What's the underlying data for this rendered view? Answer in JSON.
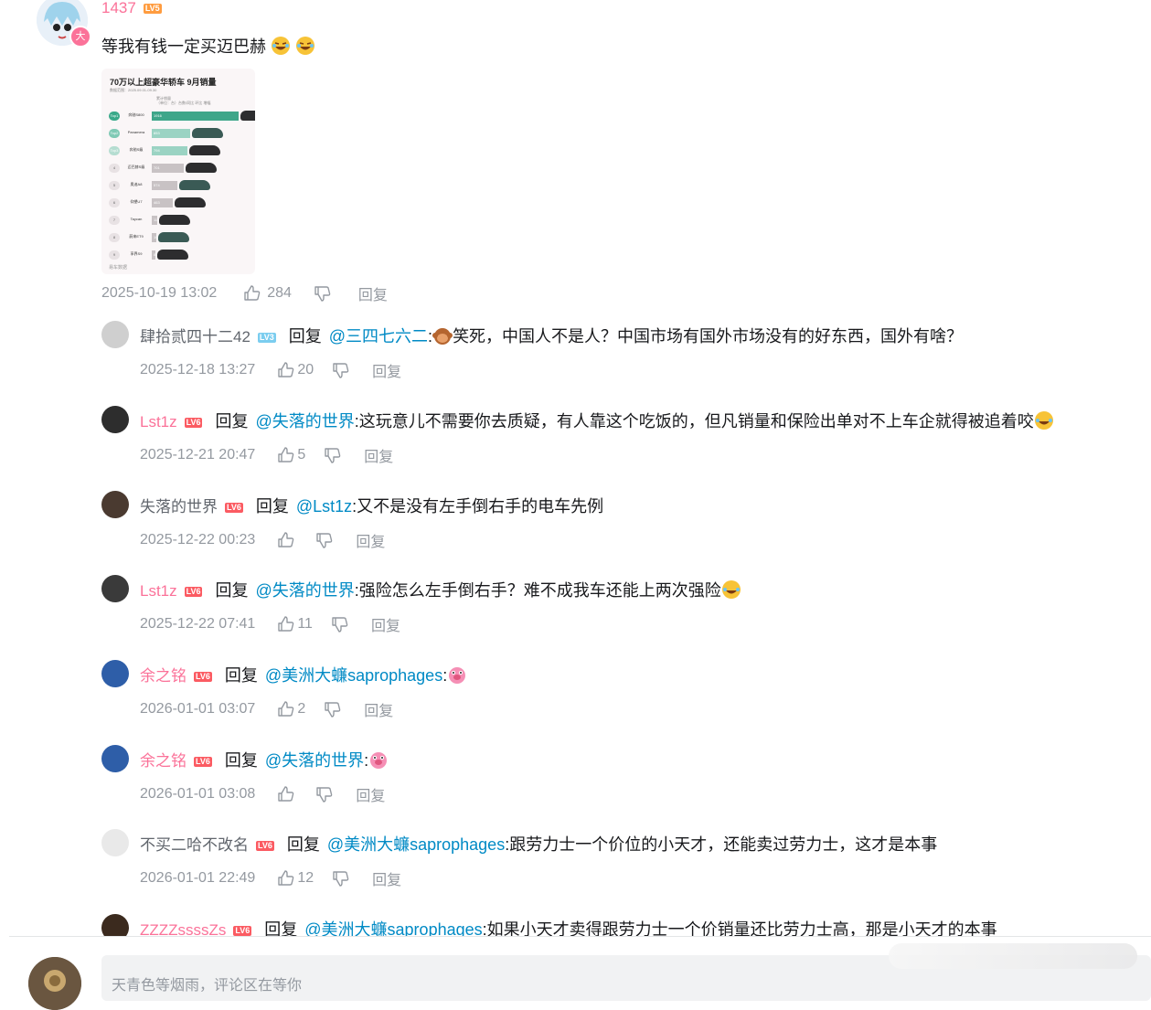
{
  "main_comment": {
    "username": "1437",
    "level": "LV5",
    "text": "等我有钱一定买迈巴赫",
    "time": "2025-10-19 13:02",
    "likes": "284",
    "reply_label": "回复",
    "image": {
      "title": "70万以上超豪华轿车 9月销量",
      "subtitle": "数据范围：2025.09.01-09.30",
      "legend_a": "累计销量",
      "legend_b": "（单位：台）",
      "legend_c": "台数/同比 环比 增幅",
      "rows": [
        {
          "rank": "Top1",
          "name": "奔驰S800",
          "value": "1916"
        },
        {
          "rank": "Top2",
          "name": "Panamera",
          "value": "853"
        },
        {
          "rank": "Top3",
          "name": "奔驰S级",
          "value": "794"
        },
        {
          "rank": "4",
          "name": "迈巴赫S级",
          "value": "701"
        },
        {
          "rank": "5",
          "name": "奥迪A8",
          "value": "574"
        },
        {
          "rank": "6",
          "name": "仰望U7",
          "value": "463"
        },
        {
          "rank": "7",
          "name": "Taycan",
          "value": "115"
        },
        {
          "rank": "8",
          "name": "蔚来ET9",
          "value": "105"
        },
        {
          "rank": "9",
          "name": "享界S9",
          "value": "85"
        }
      ],
      "footer": "易车数据"
    }
  },
  "replies": [
    {
      "username": "肆拾贰四十二42",
      "level": "LV3",
      "reply_word": "回复",
      "target": "@三四七六二",
      "text": "笑死，中国人不是人？中国市场有国外市场没有的好东西，国外有啥？",
      "time": "2025-12-18 13:27",
      "likes": "20"
    },
    {
      "username": "Lst1z",
      "level": "LV6",
      "reply_word": "回复",
      "target": "@失落的世界",
      "text": ":这玩意儿不需要你去质疑，有人靠这个吃饭的，但凡销量和保险出单对不上车企就得被追着咬",
      "time": "2025-12-21 20:47",
      "likes": "5"
    },
    {
      "username": "失落的世界",
      "level": "LV6",
      "reply_word": "回复",
      "target": "@Lst1z",
      "text": ":又不是没有左手倒右手的电车先例",
      "time": "2025-12-22 00:23",
      "likes": ""
    },
    {
      "username": "Lst1z",
      "level": "LV6",
      "reply_word": "回复",
      "target": "@失落的世界",
      "text": ":强险怎么左手倒右手？难不成我车还能上两次强险",
      "time": "2025-12-22 07:41",
      "likes": "11"
    },
    {
      "username": "余之铭",
      "level": "LV6",
      "reply_word": "回复",
      "target": "@美洲大蠊saprophages",
      "text": ":",
      "time": "2026-01-01 03:07",
      "likes": "2"
    },
    {
      "username": "余之铭",
      "level": "LV6",
      "reply_word": "回复",
      "target": "@失落的世界",
      "text": ":",
      "time": "2026-01-01 03:08",
      "likes": ""
    },
    {
      "username": "不买二哈不改名",
      "level": "LV6",
      "reply_word": "回复",
      "target": "@美洲大蠊saprophages",
      "text": ":跟劳力士一个价位的小天才，还能卖过劳力士，这才是本事",
      "time": "2026-01-01 22:49",
      "likes": "12"
    },
    {
      "username": "ZZZZssssZs",
      "level": "LV6",
      "reply_word": "回复",
      "target": "@美洲大蠊saprophages",
      "text": ":如果小天才卖得跟劳力士一个价销量还比劳力士高，那是小天才的本事",
      "time": "",
      "likes": ""
    }
  ],
  "reply_label": "回复",
  "input": {
    "placeholder": "天青色等烟雨，评论区在等你"
  },
  "colors": {
    "username_pink": "#fb7299",
    "username_gray": "#61666d",
    "link_blue": "#008ac5",
    "meta_gray": "#9499a0"
  }
}
